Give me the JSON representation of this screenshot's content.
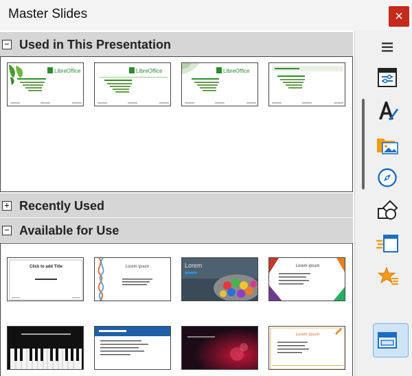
{
  "window": {
    "title": "Master Slides",
    "close_symbol": "×"
  },
  "sections": {
    "used": {
      "label": "Used in This Presentation",
      "toggle": "−"
    },
    "recent": {
      "label": "Recently Used",
      "toggle": "+"
    },
    "available": {
      "label": "Available for Use",
      "toggle": "−"
    }
  },
  "used_thumbs": [
    {
      "brand": "LibreOffice"
    },
    {
      "brand": "LibreOffice"
    },
    {
      "brand": "LibreOffice"
    },
    {
      "brand": ""
    }
  ],
  "available_thumbs": [
    {
      "title": "Click to add Title"
    },
    {
      "title": "Lorem ipsum"
    },
    {
      "title": "Lorem"
    },
    {
      "title": "Lorem ipsum"
    },
    {
      "title": ""
    },
    {
      "title": ""
    },
    {
      "title": ""
    },
    {
      "title": "Lorem ipsum"
    }
  ],
  "sidebar": {
    "menu": "hamburger-menu-icon",
    "items": [
      "properties-icon",
      "styles-icon",
      "gallery-icon",
      "navigator-icon",
      "shapes-icon",
      "slide-transition-icon",
      "animation-icon",
      "master-slides-icon"
    ],
    "active": "master-slides-icon"
  },
  "colors": {
    "close": "#c42b1c",
    "header": "#d6d6d6",
    "active": "#cfe5f7",
    "lo_green": "#2e8b2e"
  }
}
